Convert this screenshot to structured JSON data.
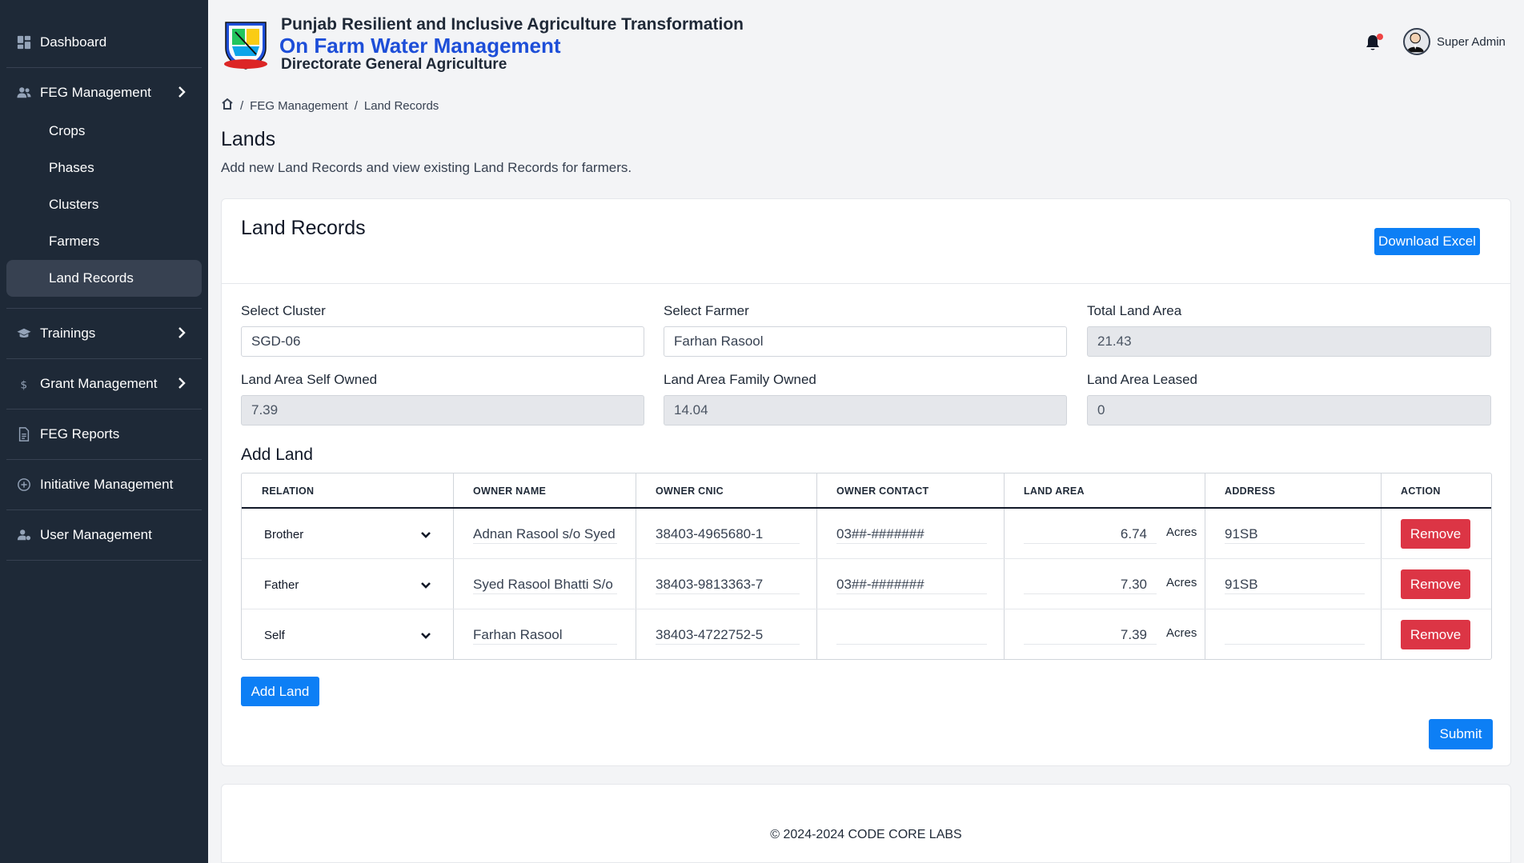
{
  "sidebar": {
    "items": [
      {
        "label": "Dashboard",
        "icon": "dashboard-icon"
      },
      {
        "label": "FEG Management",
        "icon": "users-icon",
        "expanded": true
      },
      {
        "label": "Trainings",
        "icon": "graduation-cap-icon"
      },
      {
        "label": "Grant Management",
        "icon": "dollar-icon"
      },
      {
        "label": "FEG Reports",
        "icon": "report-icon"
      },
      {
        "label": "Initiative Management",
        "icon": "plus-circle-icon"
      },
      {
        "label": "User Management",
        "icon": "user-gear-icon"
      }
    ],
    "sub_items": [
      {
        "label": "Crops"
      },
      {
        "label": "Phases"
      },
      {
        "label": "Clusters"
      },
      {
        "label": "Farmers"
      },
      {
        "label": "Land Records",
        "active": true
      }
    ]
  },
  "header": {
    "title_line1": "Punjab Resilient and Inclusive Agriculture Transformation",
    "title_line2": "On Farm Water Management",
    "title_line3": "Directorate General Agriculture",
    "user_name": "Super Admin",
    "brand_color": "#1d4ed8"
  },
  "breadcrumb": {
    "items": [
      "FEG Management",
      "Land Records"
    ]
  },
  "page": {
    "title": "Lands",
    "description": "Add new Land Records and view existing Land Records for farmers."
  },
  "card": {
    "title": "Land Records",
    "download_label": "Download Excel",
    "fields": {
      "select_cluster_label": "Select Cluster",
      "select_cluster_value": "SGD-06",
      "select_farmer_label": "Select Farmer",
      "select_farmer_value": "Farhan Rasool",
      "total_land_area_label": "Total Land Area",
      "total_land_area_value": "21.43",
      "self_owned_label": "Land Area Self Owned",
      "self_owned_value": "7.39",
      "family_owned_label": "Land Area Family Owned",
      "family_owned_value": "14.04",
      "leased_label": "Land Area Leased",
      "leased_value": "0"
    },
    "add_land_title": "Add Land",
    "table": {
      "headers": [
        "RELATION",
        "OWNER NAME",
        "OWNER CNIC",
        "OWNER CONTACT",
        "LAND AREA",
        "ADDRESS",
        "ACTION"
      ],
      "unit": "Acres",
      "remove_label": "Remove",
      "rows": [
        {
          "relation": "Brother",
          "owner_name": "Adnan Rasool s/o Syed",
          "cnic": "38403-4965680-1",
          "contact": "03##-#######",
          "area": "6.74",
          "address": "91SB"
        },
        {
          "relation": "Father",
          "owner_name": "Syed Rasool Bhatti S/o I",
          "cnic": "38403-9813363-7",
          "contact": "03##-#######",
          "area": "7.30",
          "address": "91SB"
        },
        {
          "relation": "Self",
          "owner_name": "Farhan Rasool",
          "cnic": "38403-4722752-5",
          "contact": "",
          "area": "7.39",
          "address": ""
        }
      ]
    },
    "add_land_button": "Add Land",
    "submit_button": "Submit",
    "accent_color": "#0d7ff5",
    "danger_color": "#dc3545"
  },
  "footer": {
    "text": "© 2024-2024 CODE CORE LABS"
  }
}
